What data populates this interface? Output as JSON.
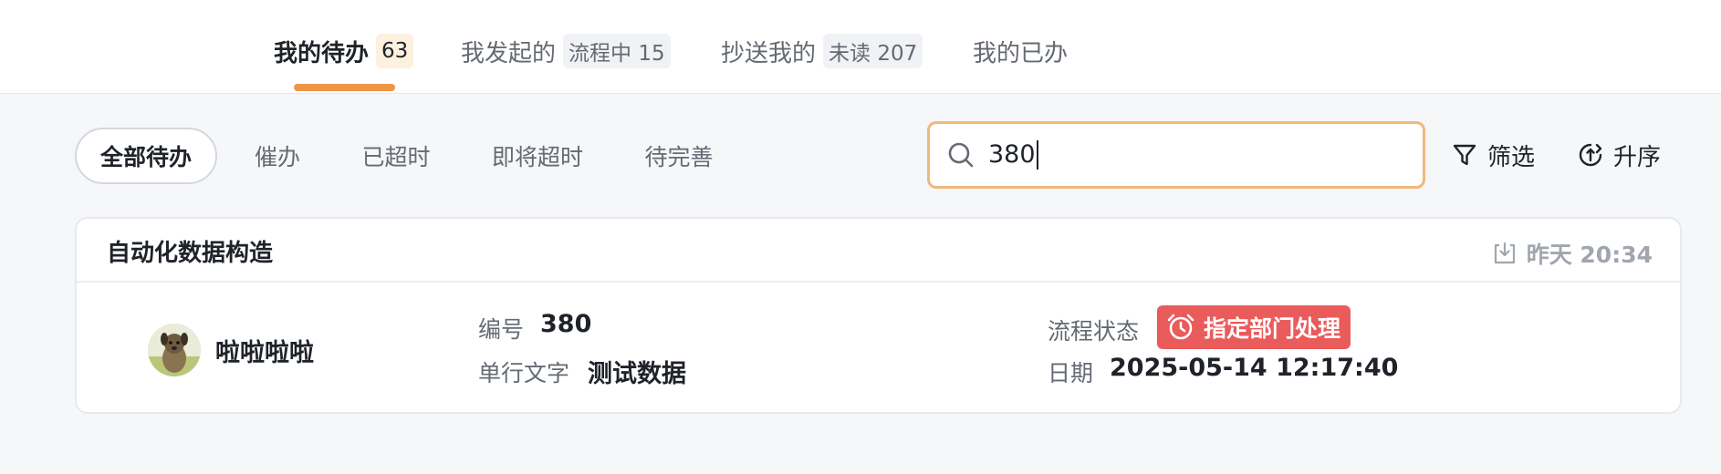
{
  "tabs": [
    {
      "label": "我的待办",
      "badge": "63"
    },
    {
      "label": "我发起的",
      "badge": "流程中 15"
    },
    {
      "label": "抄送我的",
      "badge": "未读 207"
    },
    {
      "label": "我的已办"
    }
  ],
  "filters": [
    "全部待办",
    "催办",
    "已超时",
    "即将超时",
    "待完善"
  ],
  "search": {
    "value": "380"
  },
  "tools": {
    "filter": "筛选",
    "sort": "升序"
  },
  "card": {
    "title": "自动化数据构造",
    "time": "昨天 20:34",
    "user": "啦啦啦啦",
    "fields": {
      "number_label": "编号",
      "number_value": "380",
      "text_label": "单行文字",
      "text_value": "测试数据",
      "status_label": "流程状态",
      "status_value": "指定部门处理",
      "date_label": "日期",
      "date_value": "2025-05-14 12:17:40"
    }
  },
  "colors": {
    "accent": "#ec9646",
    "search_border": "#f0b87a",
    "status_tag": "#ea5b5b"
  }
}
